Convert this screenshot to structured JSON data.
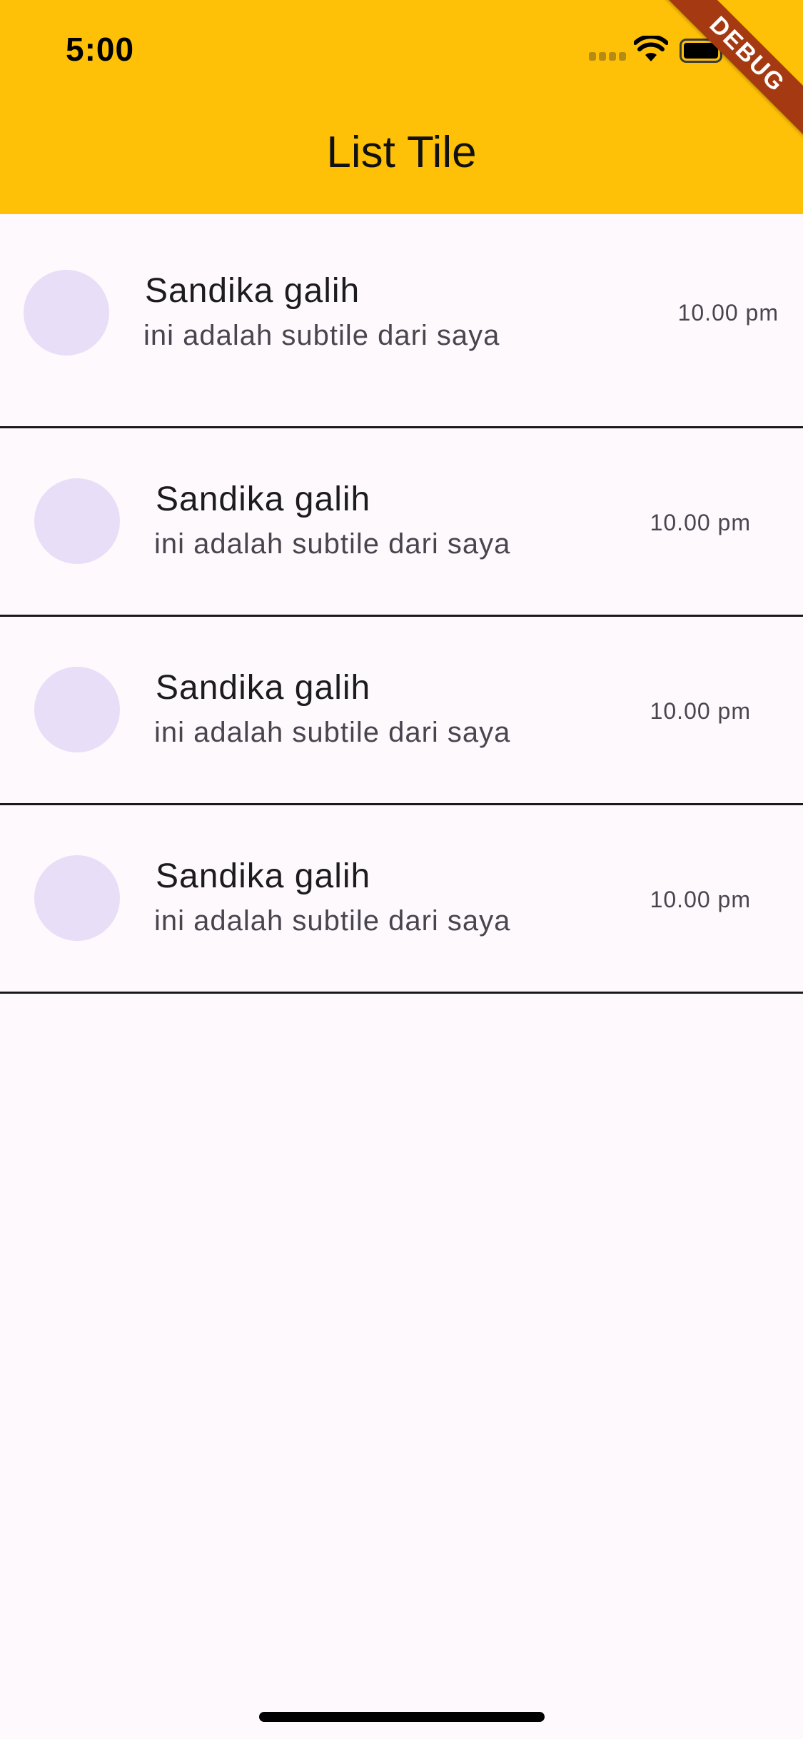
{
  "status_bar": {
    "time": "5:00"
  },
  "debug_banner": "DEBUG",
  "app_bar": {
    "title": "List Tile"
  },
  "tiles": [
    {
      "title": "Sandika galih",
      "subtitle": "ini adalah subtile dari saya",
      "trailing": "10.00 pm"
    },
    {
      "title": "Sandika galih",
      "subtitle": "ini adalah subtile dari saya",
      "trailing": "10.00 pm"
    },
    {
      "title": "Sandika galih",
      "subtitle": "ini adalah subtile dari saya",
      "trailing": "10.00 pm"
    },
    {
      "title": "Sandika galih",
      "subtitle": "ini adalah subtile dari saya",
      "trailing": "10.00 pm"
    }
  ],
  "colors": {
    "app_bar": "#FFC107",
    "background": "#FEF9FD",
    "avatar": "#E8DEF8",
    "debug_banner": "#A53A12",
    "divider": "#1A1A1A"
  }
}
